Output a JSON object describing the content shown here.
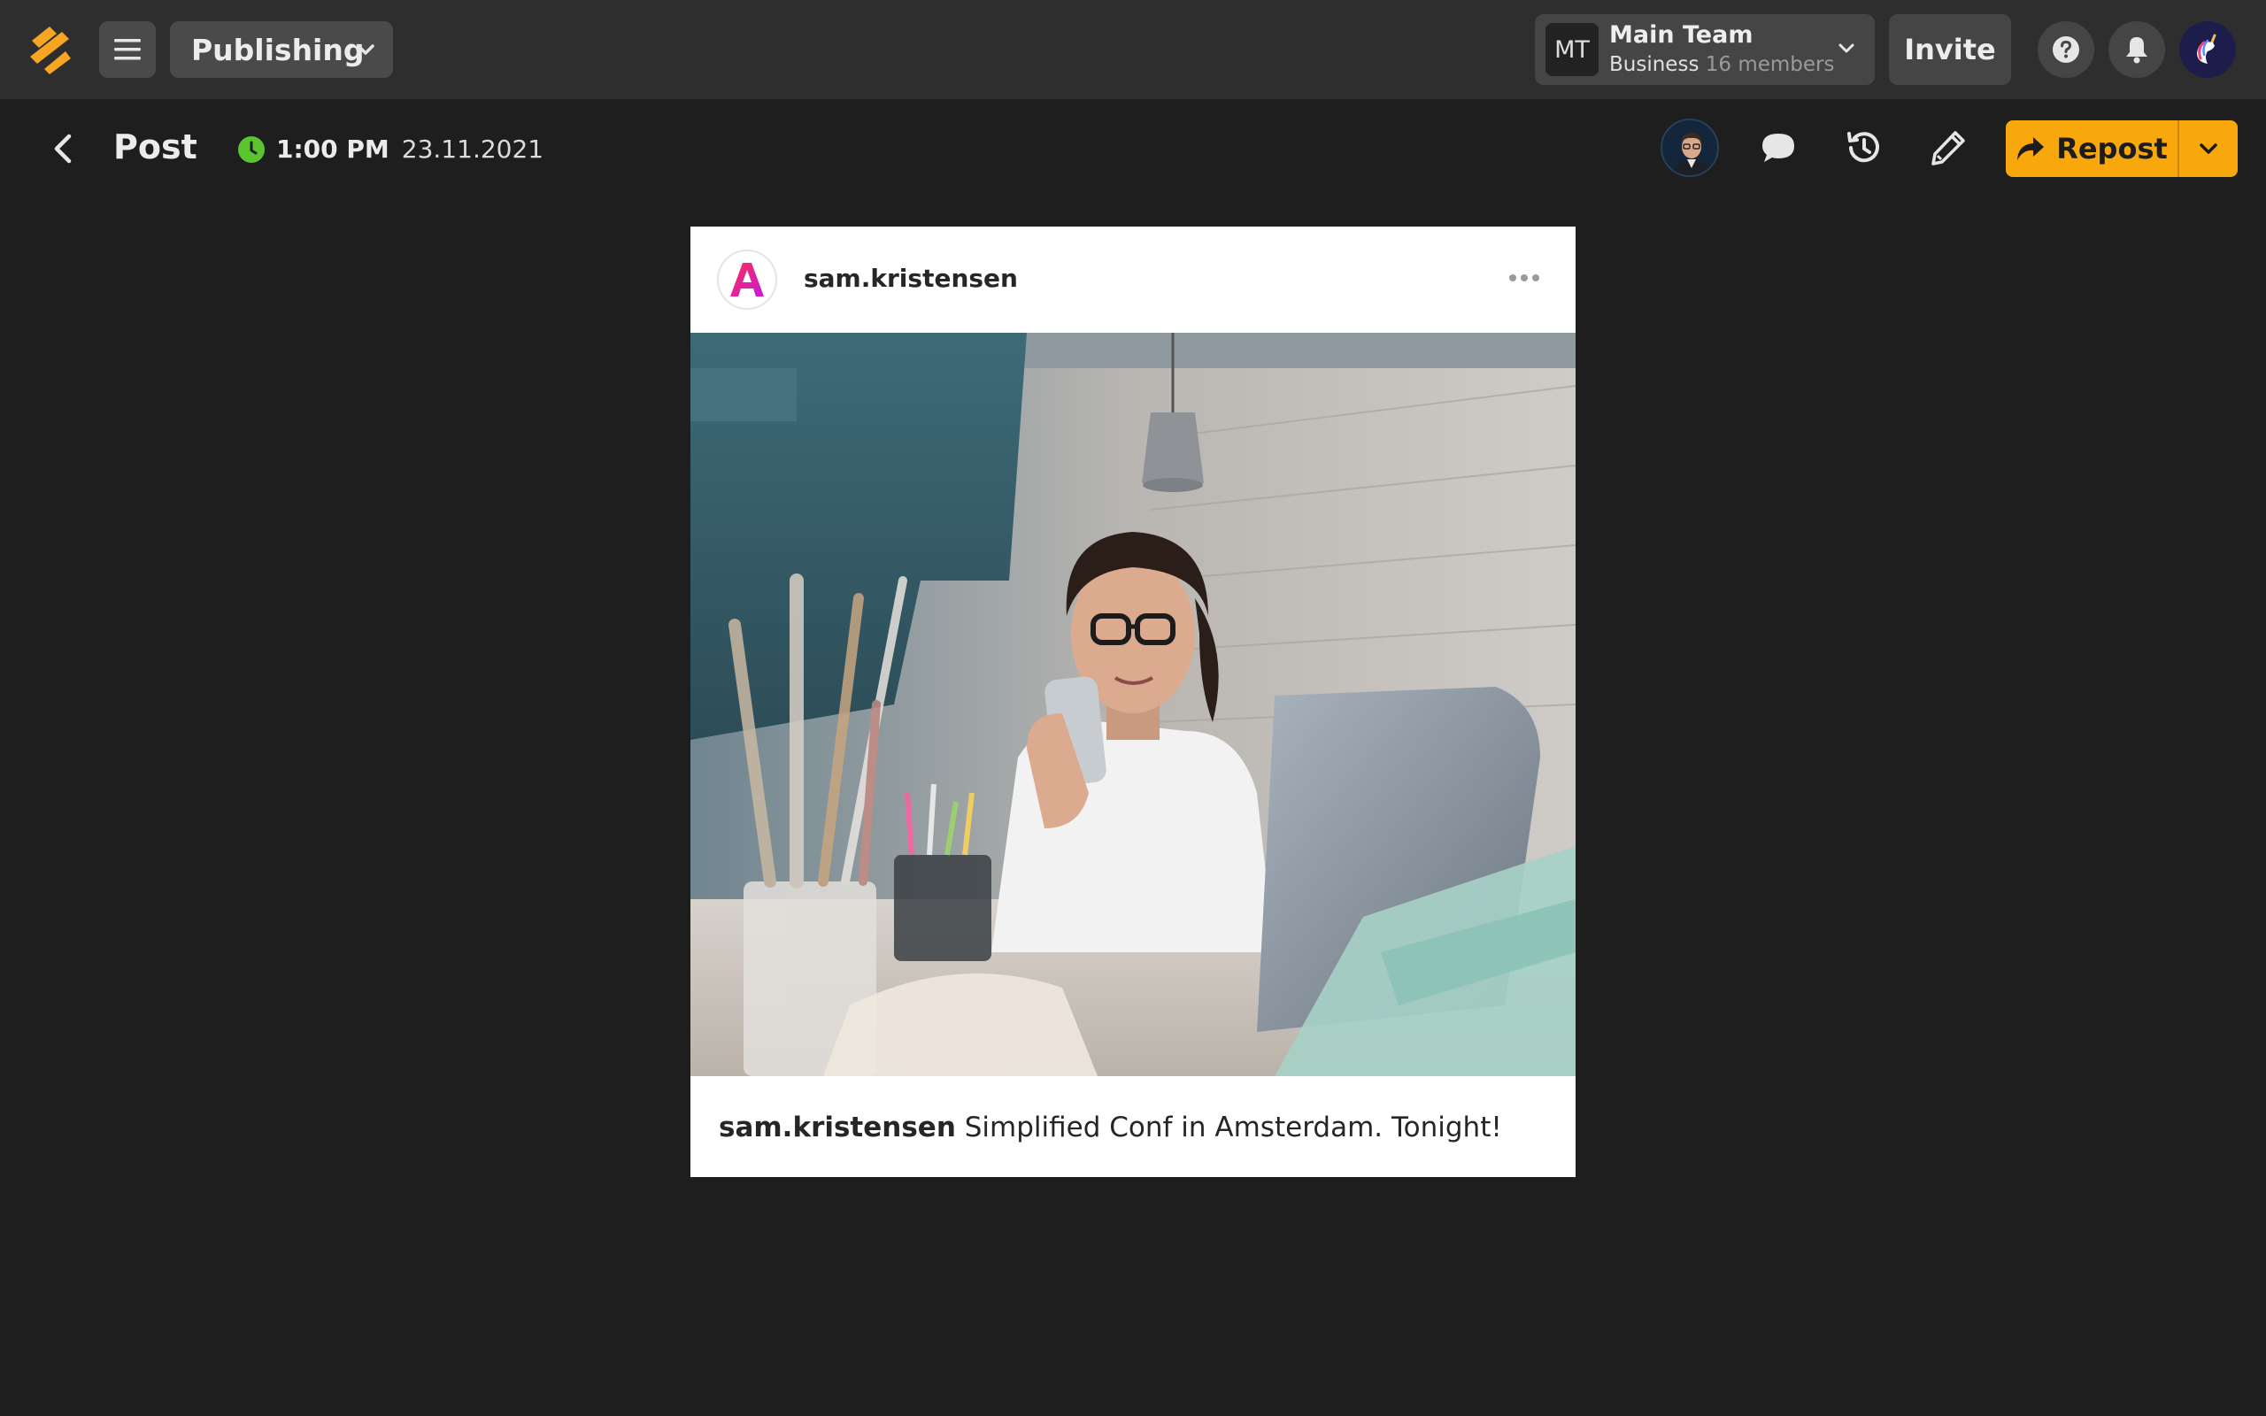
{
  "header": {
    "workspace_label": "Publishing",
    "team": {
      "initials": "MT",
      "name": "Main Team",
      "plan": "Business",
      "members": "16 members"
    },
    "invite_label": "Invite"
  },
  "subheader": {
    "title": "Post",
    "time": "1:00 PM",
    "date": "23.11.2021",
    "repost_label": "Repost"
  },
  "post": {
    "username": "sam.kristensen",
    "caption_user": "sam.kristensen",
    "caption_text": " Simplified Conf in Amsterdam. Tonight!"
  },
  "colors": {
    "accent": "#f8a70c",
    "status_green": "#5ac531",
    "topbar_bg": "#2e2e2e",
    "page_bg": "#1e1e1e"
  },
  "icons": [
    "logo-icon",
    "menu-icon",
    "chevron-down-icon",
    "help-icon",
    "bell-icon",
    "unicorn-avatar-icon",
    "back-icon",
    "clock-icon",
    "comment-icon",
    "history-icon",
    "pencil-icon",
    "repost-arrow-icon",
    "more-horizontal-icon"
  ]
}
